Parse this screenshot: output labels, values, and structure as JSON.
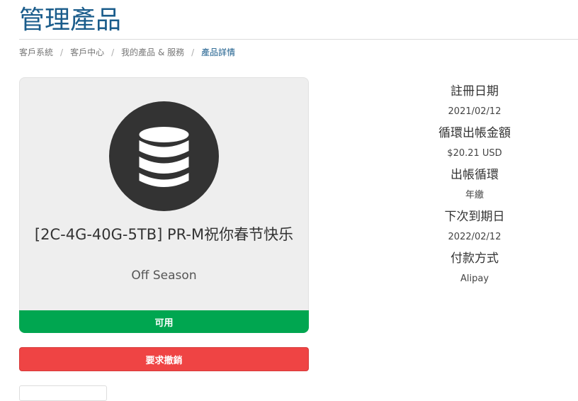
{
  "header": {
    "title": "管理產品"
  },
  "breadcrumb": {
    "items": [
      {
        "label": "客戶系統"
      },
      {
        "label": "客戶中心"
      },
      {
        "label": "我的產品 & 服務"
      },
      {
        "label": "產品詳情"
      }
    ],
    "separator": "/"
  },
  "product": {
    "icon": "database-icon",
    "name": "[2C-4G-40G-5TB] PR-M祝你春节快乐",
    "group": "Off Season",
    "status": "可用",
    "status_color": "#00a650"
  },
  "actions": {
    "cancel_label": "要求撤銷",
    "cancel_color": "#ef4444"
  },
  "details": [
    {
      "label": "註冊日期",
      "value": "2021/02/12"
    },
    {
      "label": "循環出帳金額",
      "value": "$20.21 USD"
    },
    {
      "label": "出帳循環",
      "value": "年繳"
    },
    {
      "label": "下次到期日",
      "value": "2022/02/12"
    },
    {
      "label": "付款方式",
      "value": "Alipay"
    }
  ],
  "colors": {
    "title": "#1a5c8b",
    "card_bg": "#eeeeee",
    "icon": "#333333"
  }
}
